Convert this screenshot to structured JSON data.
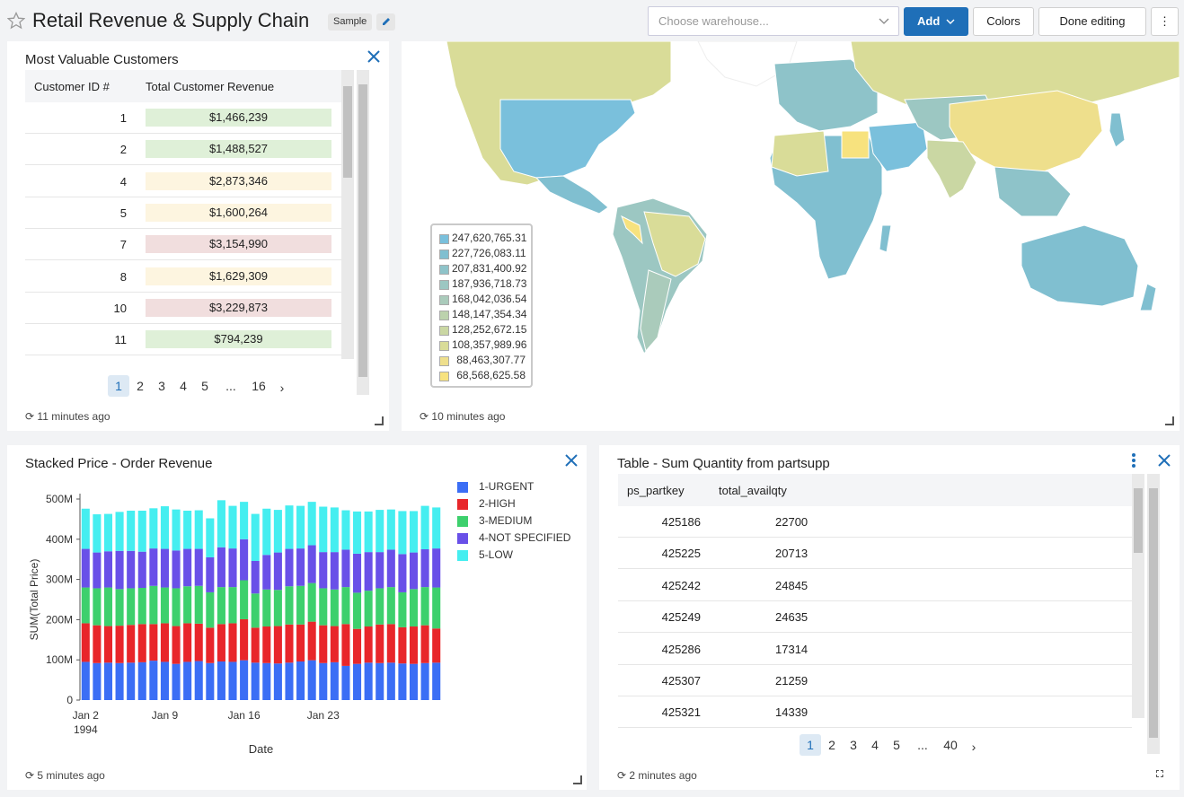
{
  "header": {
    "title": "Retail Revenue & Supply Chain",
    "badge": "Sample",
    "warehouse_placeholder": "Choose warehouse...",
    "add_label": "Add",
    "colors_label": "Colors",
    "done_label": "Done editing",
    "more_label": "⋮"
  },
  "customers": {
    "title": "Most Valuable Customers",
    "columns": [
      "Customer ID #",
      "Total Customer Revenue"
    ],
    "rows": [
      {
        "id": "1",
        "revenue": "$1,466,239",
        "tone": "#dff0d8"
      },
      {
        "id": "2",
        "revenue": "$1,488,527",
        "tone": "#dff0d8"
      },
      {
        "id": "4",
        "revenue": "$2,873,346",
        "tone": "#fdf5e0"
      },
      {
        "id": "5",
        "revenue": "$1,600,264",
        "tone": "#fdf5e0"
      },
      {
        "id": "7",
        "revenue": "$3,154,990",
        "tone": "#f1dede"
      },
      {
        "id": "8",
        "revenue": "$1,629,309",
        "tone": "#fdf5e0"
      },
      {
        "id": "10",
        "revenue": "$3,229,873",
        "tone": "#f1dede"
      },
      {
        "id": "11",
        "revenue": "$794,239",
        "tone": "#dff0d8"
      }
    ],
    "pages": [
      "1",
      "2",
      "3",
      "4",
      "5",
      "...",
      "16"
    ],
    "next": "›",
    "refreshed": "11 minutes ago"
  },
  "map": {
    "legend": [
      {
        "label": "247,620,765.31",
        "color": "#7ac0dc"
      },
      {
        "label": "227,726,083.11",
        "color": "#80bfd0"
      },
      {
        "label": "207,831,400.92",
        "color": "#8ec3c9"
      },
      {
        "label": "187,936,718.73",
        "color": "#9cc7c2"
      },
      {
        "label": "168,042,036.54",
        "color": "#aacbbb"
      },
      {
        "label": "148,147,354.34",
        "color": "#bcd2ad"
      },
      {
        "label": "128,252,672.15",
        "color": "#cad7a3"
      },
      {
        "label": "108,357,989.96",
        "color": "#d9dc98"
      },
      {
        "label": "88,463,307.77",
        "color": "#eedf8c"
      },
      {
        "label": "68,568,625.58",
        "color": "#f7e27e"
      }
    ],
    "refreshed": "10 minutes ago"
  },
  "stacked": {
    "title": "Stacked Price - Order Revenue",
    "refreshed": "5 minutes ago"
  },
  "chart_data": {
    "type": "bar",
    "title": "Stacked Price - Order Revenue",
    "xlabel": "Date",
    "ylabel": "SUM(Total Price)",
    "ylim": [
      0,
      500000000
    ],
    "yticks": [
      "0",
      "100M",
      "200M",
      "300M",
      "400M",
      "500M"
    ],
    "xticks": [
      {
        "label": "Jan 2",
        "index": 0
      },
      {
        "label": "Jan 9",
        "index": 7
      },
      {
        "label": "Jan 16",
        "index": 14
      },
      {
        "label": "Jan 23",
        "index": 21
      }
    ],
    "xyear": "1994",
    "stacked": true,
    "legend_position": "right",
    "categories": [
      "1994-01-02",
      "1994-01-03",
      "1994-01-04",
      "1994-01-05",
      "1994-01-06",
      "1994-01-07",
      "1994-01-08",
      "1994-01-09",
      "1994-01-10",
      "1994-01-11",
      "1994-01-12",
      "1994-01-13",
      "1994-01-14",
      "1994-01-15",
      "1994-01-16",
      "1994-01-17",
      "1994-01-18",
      "1994-01-19",
      "1994-01-20",
      "1994-01-21",
      "1994-01-22",
      "1994-01-23",
      "1994-01-24",
      "1994-01-25",
      "1994-01-26",
      "1994-01-27",
      "1994-01-28",
      "1994-01-29",
      "1994-01-30",
      "1994-01-31",
      "1994-02-01",
      "1994-02-02"
    ],
    "series": [
      {
        "name": "1-URGENT",
        "color": "#3b6ef5",
        "values": [
          95,
          92,
          93,
          92,
          93,
          94,
          98,
          95,
          90,
          95,
          97,
          92,
          96,
          95,
          99,
          93,
          92,
          91,
          93,
          96,
          99,
          92,
          94,
          85,
          90,
          93,
          92,
          93,
          91,
          90,
          92,
          93
        ]
      },
      {
        "name": "2-HIGH",
        "color": "#e8262a",
        "values": [
          96,
          94,
          91,
          93,
          94,
          95,
          91,
          96,
          94,
          96,
          93,
          88,
          93,
          96,
          102,
          87,
          91,
          93,
          95,
          92,
          96,
          94,
          90,
          104,
          87,
          90,
          96,
          96,
          90,
          93,
          94,
          85
        ]
      },
      {
        "name": "3-MEDIUM",
        "color": "#3dd06d",
        "values": [
          89,
          92,
          96,
          91,
          91,
          90,
          95,
          89,
          94,
          92,
          94,
          88,
          92,
          90,
          97,
          85,
          92,
          90,
          95,
          96,
          96,
          92,
          91,
          92,
          90,
          89,
          90,
          92,
          87,
          93,
          95,
          102
        ]
      },
      {
        "name": "4-NOT SPECIFIED",
        "color": "#6950e8",
        "values": [
          96,
          89,
          90,
          95,
          93,
          90,
          93,
          96,
          94,
          93,
          92,
          87,
          99,
          96,
          102,
          81,
          86,
          93,
          93,
          93,
          94,
          90,
          93,
          93,
          97,
          96,
          90,
          93,
          95,
          91,
          94,
          97
        ]
      },
      {
        "name": "5-LOW",
        "color": "#45eef0",
        "values": [
          100,
          95,
          93,
          97,
          100,
          102,
          100,
          106,
          102,
          95,
          96,
          97,
          117,
          106,
          93,
          117,
          115,
          106,
          108,
          106,
          108,
          113,
          111,
          98,
          105,
          101,
          105,
          100,
          107,
          103,
          108,
          102
        ]
      }
    ]
  },
  "partsupp": {
    "title": "Table - Sum Quantity from partsupp",
    "columns": [
      "ps_partkey",
      "total_availqty"
    ],
    "rows": [
      {
        "key": "425186",
        "qty": "22700"
      },
      {
        "key": "425225",
        "qty": "20713"
      },
      {
        "key": "425242",
        "qty": "24845"
      },
      {
        "key": "425249",
        "qty": "24635"
      },
      {
        "key": "425286",
        "qty": "17314"
      },
      {
        "key": "425307",
        "qty": "21259"
      },
      {
        "key": "425321",
        "qty": "14339"
      }
    ],
    "pages": [
      "1",
      "2",
      "3",
      "4",
      "5",
      "...",
      "40"
    ],
    "next": "›",
    "refreshed": "2 minutes ago"
  }
}
